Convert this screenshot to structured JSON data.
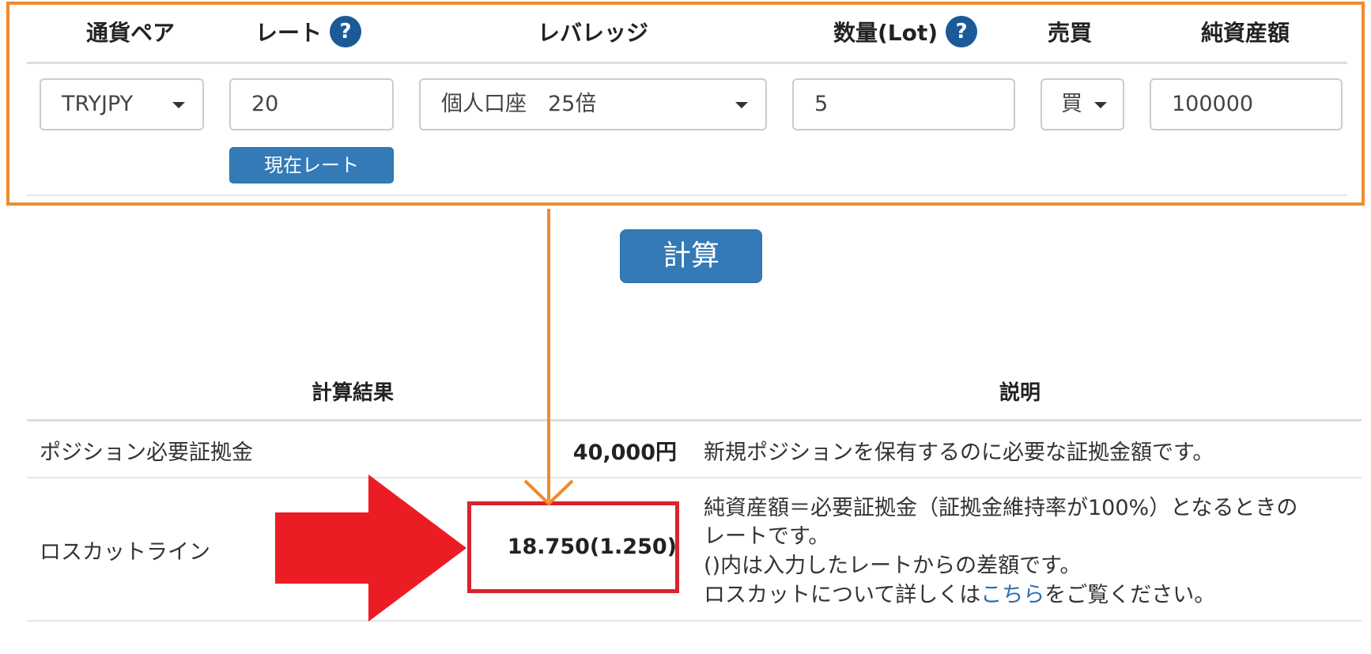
{
  "form": {
    "headers": {
      "currency_pair": "通貨ペア",
      "rate": "レート",
      "leverage": "レバレッジ",
      "quantity": "数量(Lot)",
      "trade": "売買",
      "net_assets": "純資産額"
    },
    "help_mark": "?",
    "currency_pair_value": "TRYJPY",
    "rate_value": "20",
    "current_rate_button": "現在レート",
    "leverage_value": "個人口座　25倍",
    "quantity_value": "5",
    "trade_value": "買",
    "net_assets_value": "100000"
  },
  "calculate_button": "計算",
  "results": {
    "headers": {
      "result": "計算結果",
      "description": "説明"
    },
    "rows": [
      {
        "label": "ポジション必要証拠金",
        "value": "40,000円",
        "description": [
          "新規ポジションを保有するのに必要な証拠金額です。"
        ]
      },
      {
        "label": "ロスカットライン",
        "value": "18.750(1.250)",
        "description": [
          "純資産額＝必要証拠金（証拠金維持率が100%）となるときの",
          "レートです。",
          "()内は入力したレートからの差額です。"
        ],
        "description_last_prefix": "ロスカットについて詳しくは",
        "description_link": "こちら",
        "description_last_suffix": "をご覧ください。"
      }
    ]
  },
  "colors": {
    "highlight_orange": "#ef8b2c",
    "highlight_red": "#d9232e",
    "arrow_red": "#ec1c24",
    "button_blue": "#337ab7",
    "help_blue": "#1a5a97",
    "link_blue": "#2a6fb0"
  },
  "icons": [
    "help-icon",
    "caret-down-icon",
    "arrow-down-icon",
    "big-red-arrow-icon"
  ]
}
